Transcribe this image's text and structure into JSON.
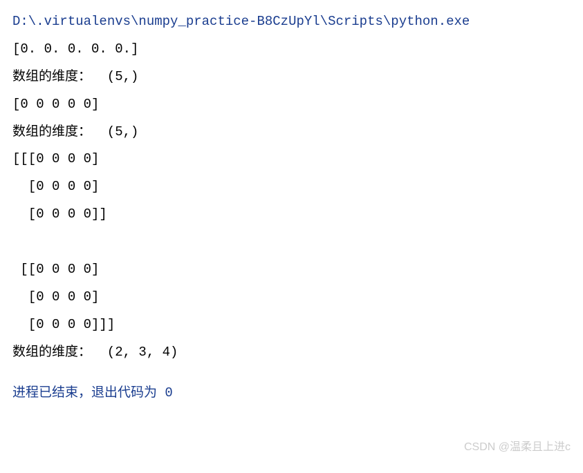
{
  "console": {
    "path": "D:\\.virtualenvs\\numpy_practice-B8CzUpYl\\Scripts\\python.exe",
    "lines": [
      "[0. 0. 0. 0. 0.]",
      "数组的维度：  (5,)",
      "[0 0 0 0 0]",
      "数组的维度：  (5,)",
      "[[[0 0 0 0]",
      "  [0 0 0 0]",
      "  [0 0 0 0]]",
      "",
      " [[0 0 0 0]",
      "  [0 0 0 0]",
      "  [0 0 0 0]]]",
      "数组的维度：  (2, 3, 4)"
    ],
    "exit_message": "进程已结束，退出代码为 0"
  },
  "watermark": "CSDN @温柔且上进c"
}
